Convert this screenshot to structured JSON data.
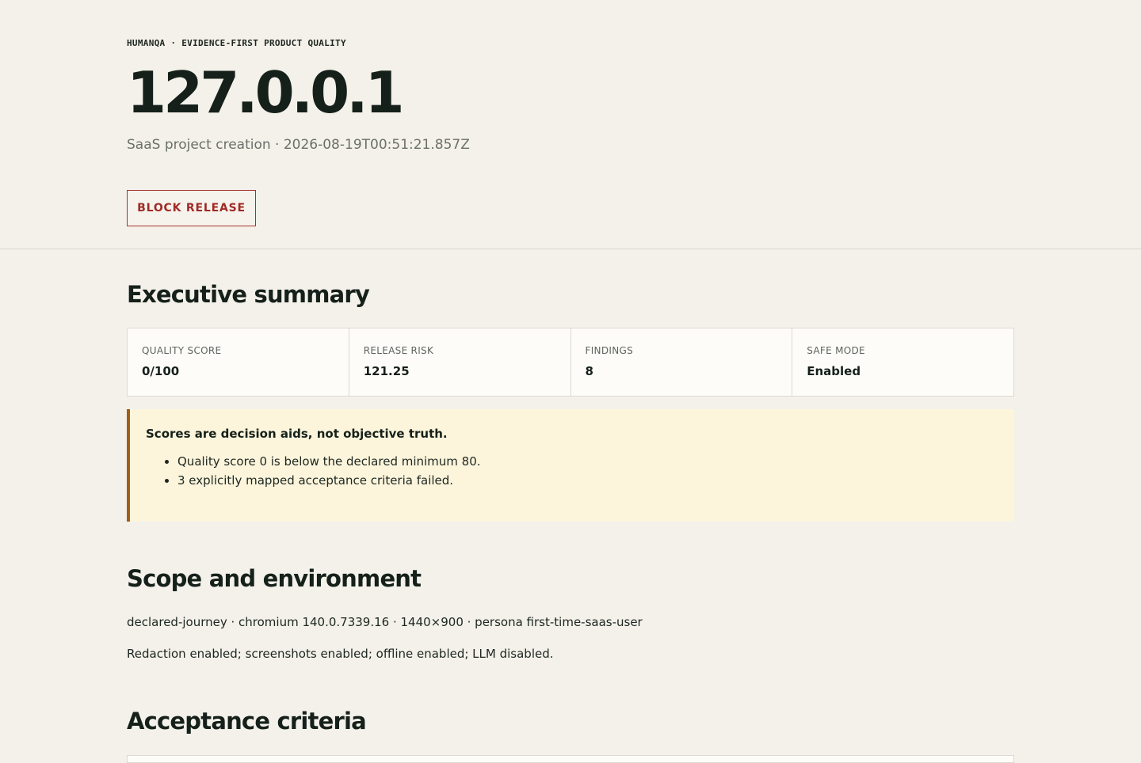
{
  "header": {
    "eyebrow": "HUMANQA · EVIDENCE-FIRST PRODUCT QUALITY",
    "host": "127.0.0.1",
    "subtitle": "SaaS project creation · 2026-08-19T00:51:21.857Z",
    "verdict_label": "BLOCK RELEASE",
    "verdict_color": "#a02a26"
  },
  "executive_summary": {
    "heading": "Executive summary",
    "metrics": [
      {
        "label": "QUALITY SCORE",
        "value": "0/100"
      },
      {
        "label": "RELEASE RISK",
        "value": "121.25"
      },
      {
        "label": "FINDINGS",
        "value": "8"
      },
      {
        "label": "SAFE MODE",
        "value": "Enabled"
      }
    ],
    "callout": {
      "title": "Scores are decision aids, not objective truth.",
      "items": [
        "Quality score 0 is below the declared minimum 80.",
        "3 explicitly mapped acceptance criteria failed."
      ],
      "accent_color": "#a45d14"
    }
  },
  "scope": {
    "heading": "Scope and environment",
    "line1": "declared-journey · chromium 140.0.7339.16 · 1440×900 · persona first-time-saas-user",
    "line2": "Redaction enabled; screenshots enabled; offline enabled; LLM disabled."
  },
  "acceptance": {
    "heading": "Acceptance criteria"
  }
}
